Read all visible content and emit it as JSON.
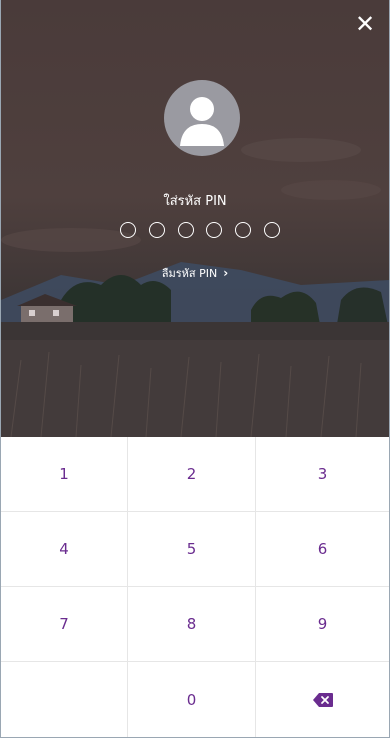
{
  "pin_screen": {
    "title": "ใส่รหัส PIN",
    "forgot_label": "ลืมรหัส PIN",
    "pin_length": 6,
    "close_icon": "close-icon",
    "avatar_icon": "user-avatar-icon"
  },
  "keypad": {
    "keys": [
      "1",
      "2",
      "3",
      "4",
      "5",
      "6",
      "7",
      "8",
      "9",
      "",
      "0"
    ],
    "backspace_icon": "backspace-icon",
    "accent_color": "#6a2c8f"
  }
}
